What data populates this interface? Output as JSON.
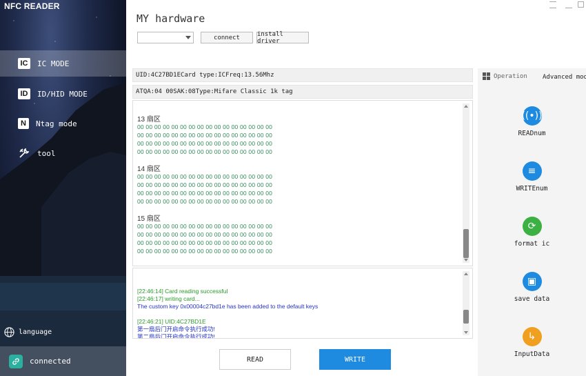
{
  "app": {
    "title": "NFC READER"
  },
  "sidebar": {
    "items": [
      {
        "icon": "IC",
        "label": "IC MODE",
        "active": true
      },
      {
        "icon": "ID",
        "label": "ID/HID MODE"
      },
      {
        "icon": "N",
        "label": "Ntag mode"
      },
      {
        "icon": "tool-icon",
        "label": "tool"
      }
    ],
    "language_label": "language",
    "connection_label": "connected"
  },
  "header": {
    "title": "MY hardware",
    "device_select_value": "",
    "connect_label": "connect",
    "install_driver_label": "install driver"
  },
  "card_info": {
    "uid": "UID:4C27BD1E",
    "card_type": "Card type:IC",
    "freq": "Freq:13.56Mhz",
    "atqa": "ATQA:04 00",
    "sak": "SAK:08",
    "type": "Type:Mifare Classic 1k tag"
  },
  "sectors": [
    {
      "title": "13 扇区",
      "rows": [
        "00 00 00 00 00 00 00 00 00 00 00 00 00 00 00 00",
        "00 00 00 00 00 00 00 00 00 00 00 00 00 00 00 00",
        "00 00 00 00 00 00 00 00 00 00 00 00 00 00 00 00",
        "00 00 00 00 00 00 00 00 00 00 00 00 00 00 00 00"
      ]
    },
    {
      "title": "14 扇区",
      "rows": [
        "00 00 00 00 00 00 00 00 00 00 00 00 00 00 00 00",
        "00 00 00 00 00 00 00 00 00 00 00 00 00 00 00 00",
        "00 00 00 00 00 00 00 00 00 00 00 00 00 00 00 00",
        "00 00 00 00 00 00 00 00 00 00 00 00 00 00 00 00"
      ]
    },
    {
      "title": "15 扇区",
      "rows": [
        "00 00 00 00 00 00 00 00 00 00 00 00 00 00 00 00",
        "00 00 00 00 00 00 00 00 00 00 00 00 00 00 00 00",
        "00 00 00 00 00 00 00 00 00 00 00 00 00 00 00 00",
        "00 00 00 00 00 00 00 00 00 00 00 00 00 00 00 00"
      ]
    }
  ],
  "log": [
    {
      "text": "[22:46:14] Card reading successful",
      "color": "green"
    },
    {
      "text": "[22:46:17] writing card...",
      "color": "green"
    },
    {
      "text": "The custom key 0x00004c27bd1e has been added to the default keys",
      "color": "blue"
    },
    {
      "text": "",
      "color": "gap"
    },
    {
      "text": "[22:46:21] UID:4C27BD1E",
      "color": "green"
    },
    {
      "text": "第一扇后门开启命令执行成功!",
      "color": "blue"
    },
    {
      "text": "第二扇后门开启命令执行成功!",
      "color": "blue"
    }
  ],
  "actions": {
    "read_label": "READ",
    "write_label": "WRITE"
  },
  "operation": {
    "header": "Operation",
    "advanced_mode": "Advanced mode",
    "buttons": [
      {
        "label": "READnum",
        "icon": "readnum-icon",
        "color": "#1e8be0"
      },
      {
        "label": "WRITEnum",
        "icon": "writenum-icon",
        "color": "#1e8be0"
      },
      {
        "label": "format ic",
        "icon": "format-icon",
        "color": "#3cb043"
      },
      {
        "label": "save data",
        "icon": "save-icon",
        "color": "#1e8be0"
      },
      {
        "label": "InputData",
        "icon": "input-icon",
        "color": "#f0a020"
      }
    ]
  }
}
